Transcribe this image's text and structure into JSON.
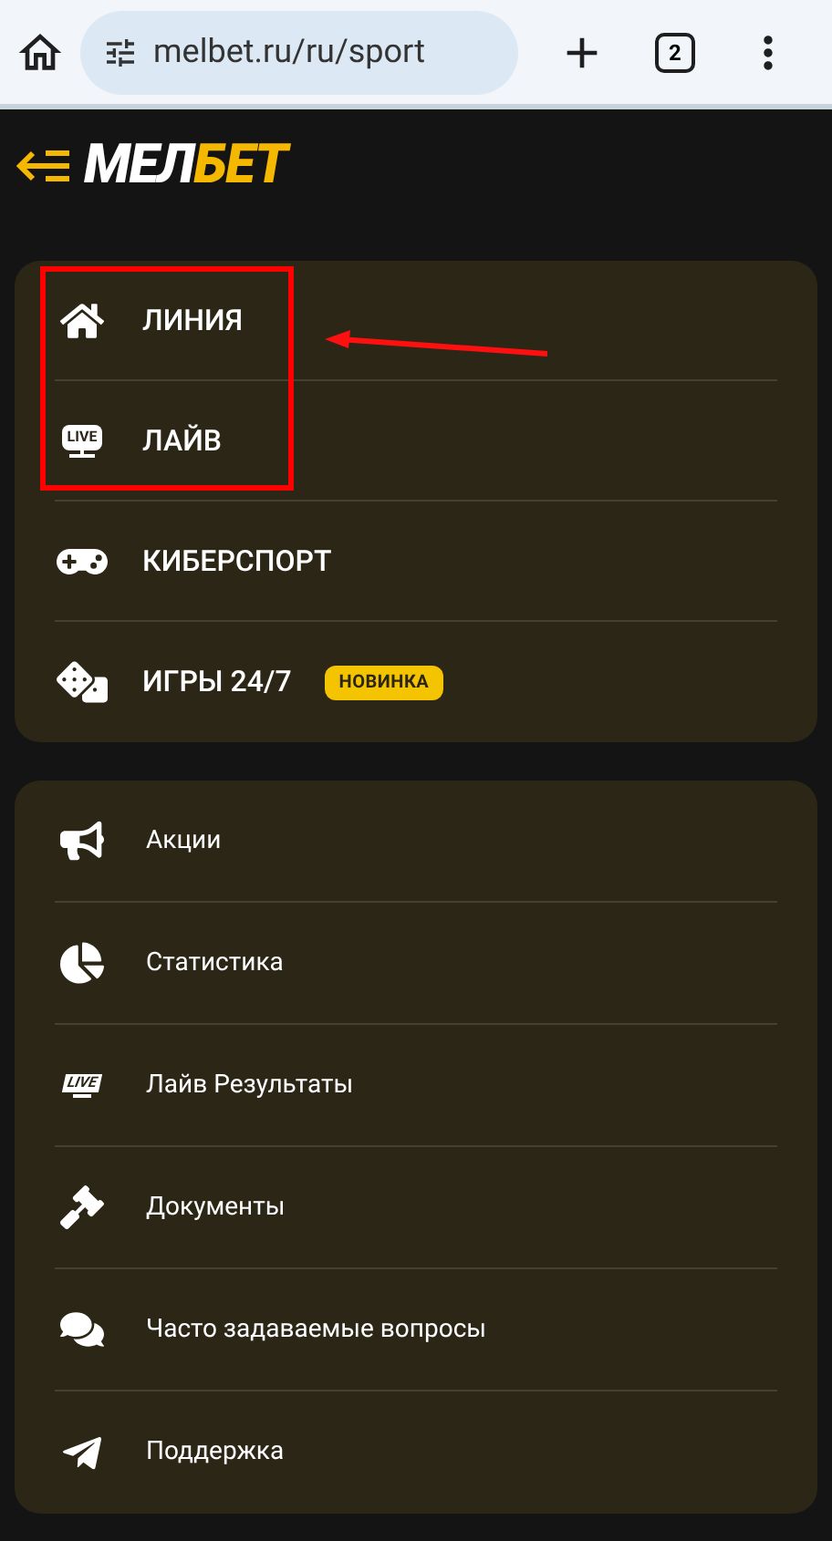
{
  "browser": {
    "url": "melbet.ru/ru/sport",
    "tab_count": "2"
  },
  "logo": {
    "part_1": "МЕЛ",
    "part_2": "БЕТ"
  },
  "main_menu": [
    {
      "label": "ЛИНИЯ",
      "kind": "plain"
    },
    {
      "label": "ЛАЙВ",
      "kind": "live",
      "icon_text": "LIVE"
    },
    {
      "label": "КИБЕРСПОРТ",
      "kind": "plain"
    },
    {
      "label": "ИГРЫ 24/7",
      "kind": "plain",
      "badge": "НОВИНКА"
    }
  ],
  "annotation": {
    "box": true,
    "arrow": true
  },
  "secondary_menu": [
    {
      "label": "Акции",
      "kind": "plain"
    },
    {
      "label": "Статистика",
      "kind": "plain"
    },
    {
      "label": "Лайв Результаты",
      "kind": "live",
      "icon_text": "LIVE"
    },
    {
      "label": "Документы",
      "kind": "plain"
    },
    {
      "label": "Часто задаваемые вопросы",
      "kind": "plain"
    },
    {
      "label": "Поддержка",
      "kind": "plain"
    }
  ]
}
